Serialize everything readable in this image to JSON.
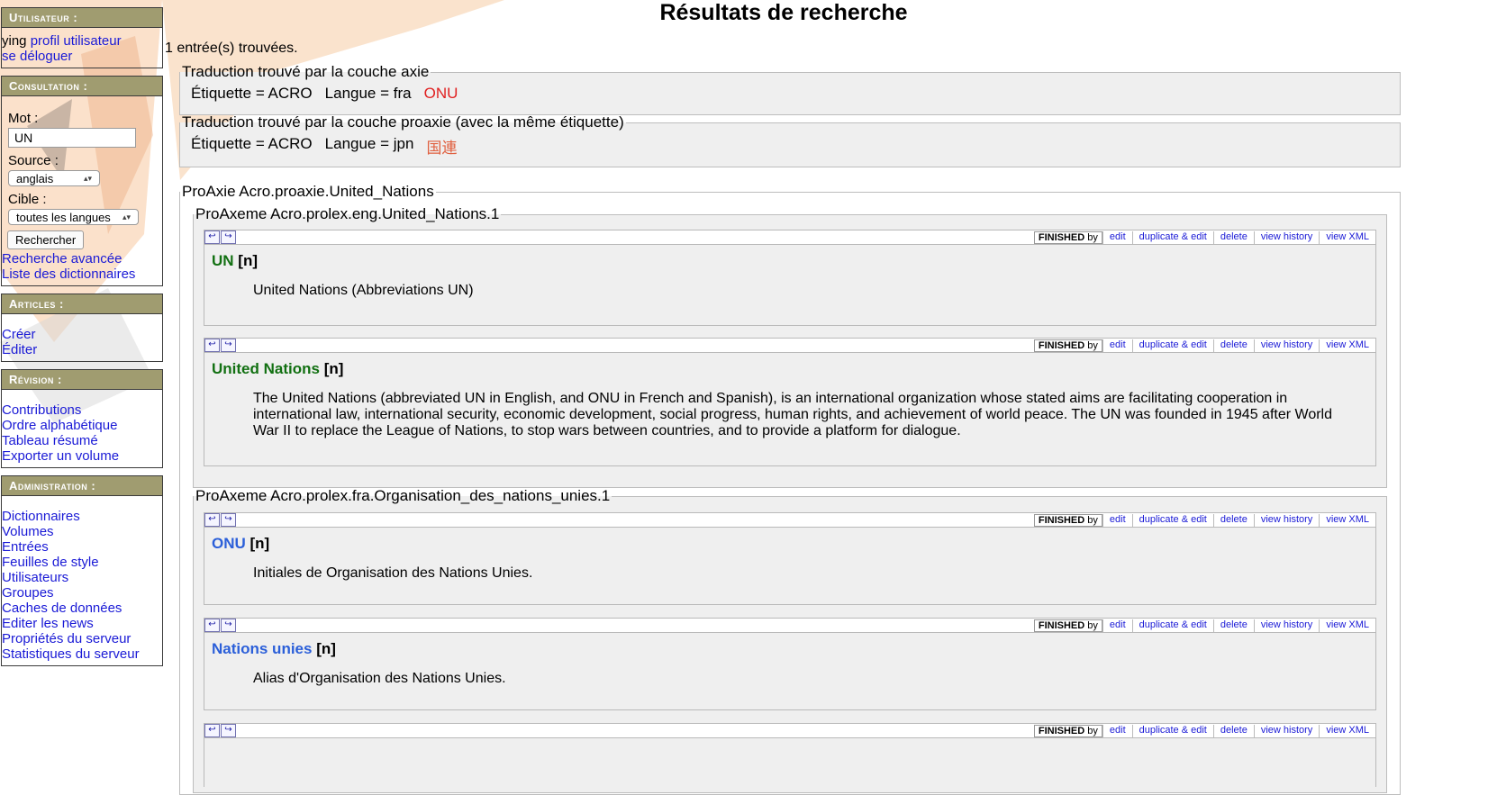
{
  "page": {
    "title": "Résultats de recherche",
    "count": "1 entrée(s) trouvées."
  },
  "sidebar": {
    "user": {
      "title": "Utilisateur :",
      "username": "ying",
      "profile_link": "profil utilisateur",
      "logout_link": "se déloguer"
    },
    "consultation": {
      "title": "Consultation :",
      "mot_label": "Mot :",
      "mot_value": "UN",
      "source_label": "Source :",
      "source_value": "anglais",
      "cible_label": "Cible :",
      "cible_value": "toutes les langues",
      "search_button": "Rechercher",
      "advanced_link": "Recherche avancée",
      "dicts_link": "Liste des dictionnaires"
    },
    "articles": {
      "title": "Articles :",
      "items": [
        "Créer",
        "Éditer"
      ]
    },
    "revision": {
      "title": "Révision :",
      "items": [
        "Contributions",
        "Ordre alphabétique",
        "Tableau résumé",
        "Exporter un volume"
      ]
    },
    "admin": {
      "title": "Administration :",
      "items": [
        "Dictionnaires",
        "Volumes",
        "Entrées",
        "Feuilles de style",
        "Utilisateurs",
        "Groupes",
        "Caches de données",
        "Editer les news",
        "Propriétés du serveur",
        "Statistiques du serveur"
      ]
    }
  },
  "axie": {
    "legend": "Traduction trouvé par la couche axie",
    "label": "Étiquette = ACRO",
    "lang": "Langue = fra",
    "value": "ONU"
  },
  "proaxie_trans": {
    "legend": "Traduction trouvé par la couche proaxie (avec la même étiquette)",
    "label": "Étiquette = ACRO",
    "lang": "Langue = jpn",
    "value": "国連"
  },
  "proaxie": {
    "legend": "ProAxie Acro.proaxie.United_Nations",
    "proaxeme_eng": "ProAxeme Acro.prolex.eng.United_Nations.1",
    "proaxeme_fra": "ProAxeme Acro.prolex.fra.Organisation_des_nations_unies.1"
  },
  "entry_actions": {
    "status": "FINISHED",
    "by": "by",
    "edit": "edit",
    "duplicate": "duplicate & edit",
    "delete": "delete",
    "history": "view history",
    "xml": "view XML"
  },
  "entries": [
    {
      "headword": "UN",
      "pos": "[n]",
      "definition": "United Nations (Abbreviations UN)"
    },
    {
      "headword": "United Nations",
      "pos": "[n]",
      "definition": "The United Nations (abbreviated UN in English, and ONU in French and Spanish), is an international organization whose stated aims are facilitating cooperation in international law, international security, economic development, social progress, human rights, and achievement of world peace. The UN was founded in 1945 after World War II to replace the League of Nations, to stop wars between countries, and to provide a platform for dialogue."
    },
    {
      "headword": "ONU",
      "pos": "[n]",
      "definition": "Initiales de Organisation des Nations Unies."
    },
    {
      "headword": "Nations unies",
      "pos": "[n]",
      "definition": "Alias d'Organisation des Nations Unies."
    }
  ],
  "icons": {
    "undo": "undo-arrow-icon",
    "redo": "redo-arrow-icon"
  }
}
